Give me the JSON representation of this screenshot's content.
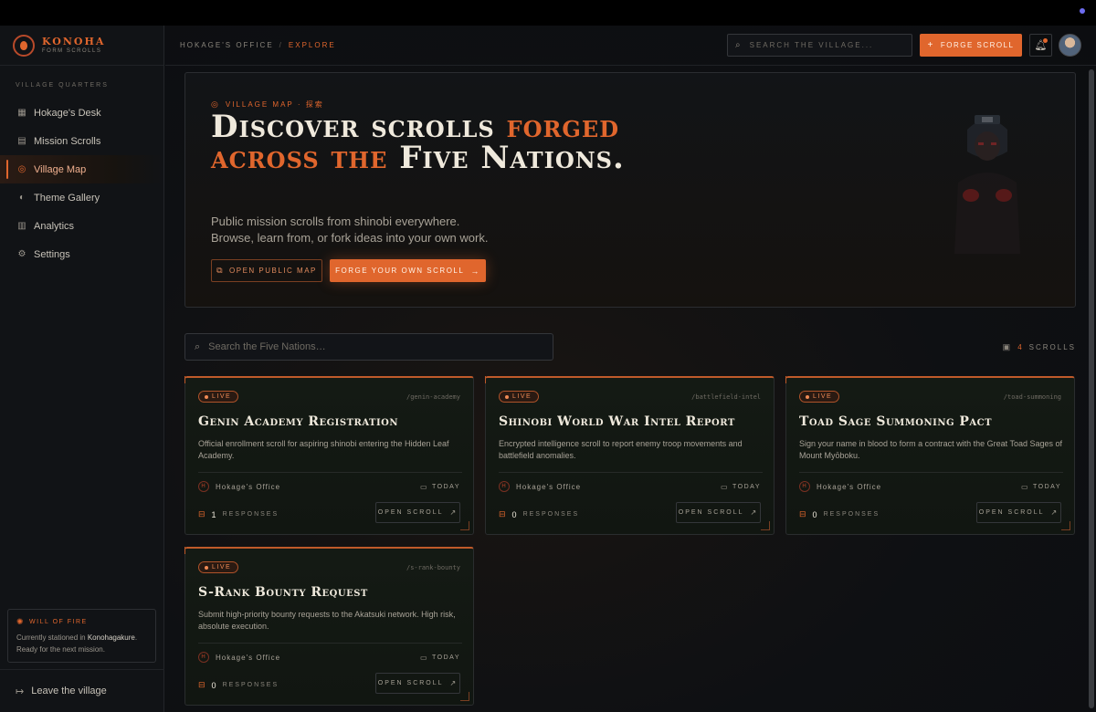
{
  "brand": {
    "name": "KONOHA",
    "subtitle": "FORM SCROLLS"
  },
  "sidebar": {
    "section_label": "VILLAGE QUARTERS",
    "items": [
      {
        "label": "Hokage's Desk",
        "icon": "grid-icon",
        "glyph": "▦",
        "active": false
      },
      {
        "label": "Mission Scrolls",
        "icon": "scroll-icon",
        "glyph": "▤",
        "active": false
      },
      {
        "label": "Village Map",
        "icon": "compass-icon",
        "glyph": "◎",
        "active": true
      },
      {
        "label": "Theme Gallery",
        "icon": "palette-icon",
        "glyph": "◐",
        "active": false
      },
      {
        "label": "Analytics",
        "icon": "bar-chart-icon",
        "glyph": "▥",
        "active": false
      },
      {
        "label": "Settings",
        "icon": "gear-icon",
        "glyph": "⚙",
        "active": false
      }
    ],
    "will_of_fire": {
      "title": "WILL OF FIRE",
      "text_prefix": "Currently stationed in ",
      "location": "Konohagakure",
      "text_suffix": ". Ready for the next mission."
    },
    "leave_label": "Leave the village"
  },
  "header": {
    "breadcrumb_root": "HOKAGE'S OFFICE",
    "breadcrumb_sep": "/",
    "breadcrumb_current": "EXPLORE",
    "search_placeholder": "SEARCH THE VILLAGE...",
    "forge_label": "FORGE SCROLL"
  },
  "hero": {
    "kicker": "VILLAGE MAP · 探索",
    "title_part1": "Discover scrolls ",
    "title_accent": "forged across the",
    "title_part2": " Five Nations.",
    "description": "Public mission scrolls from shinobi everywhere. Browse, learn from, or fork ideas into your own work.",
    "open_map_label": "OPEN PUBLIC MAP",
    "forge_own_label": "FORGE YOUR OWN SCROLL"
  },
  "filter": {
    "search_placeholder": "Search the Five Nations…",
    "count": "4",
    "count_label": "SCROLLS"
  },
  "cards": [
    {
      "status": "LIVE",
      "slug": "/genin-academy",
      "title": "Genin Academy Registration",
      "description": "Official enrollment scroll for aspiring shinobi entering the Hidden Leaf Academy.",
      "owner": "Hokage's Office",
      "date": "TODAY",
      "responses": "1",
      "responses_label": "RESPONSES",
      "open_label": "OPEN SCROLL"
    },
    {
      "status": "LIVE",
      "slug": "/battlefield-intel",
      "title": "Shinobi World War Intel Report",
      "description": "Encrypted intelligence scroll to report enemy troop movements and battlefield anomalies.",
      "owner": "Hokage's Office",
      "date": "TODAY",
      "responses": "0",
      "responses_label": "RESPONSES",
      "open_label": "OPEN SCROLL"
    },
    {
      "status": "LIVE",
      "slug": "/toad-summoning",
      "title": "Toad Sage Summoning Pact",
      "description": "Sign your name in blood to form a contract with the Great Toad Sages of Mount Myōboku.",
      "owner": "Hokage's Office",
      "date": "TODAY",
      "responses": "0",
      "responses_label": "RESPONSES",
      "open_label": "OPEN SCROLL"
    },
    {
      "status": "LIVE",
      "slug": "/s-rank-bounty",
      "title": "S-Rank Bounty Request",
      "description": "Submit high-priority bounty requests to the Akatsuki network. High risk, absolute execution.",
      "owner": "Hokage's Office",
      "date": "TODAY",
      "responses": "0",
      "responses_label": "RESPONSES",
      "open_label": "OPEN SCROLL"
    }
  ],
  "colors": {
    "accent": "#e0662d",
    "background": "#0d0f12",
    "card_bg": "#141a14"
  }
}
